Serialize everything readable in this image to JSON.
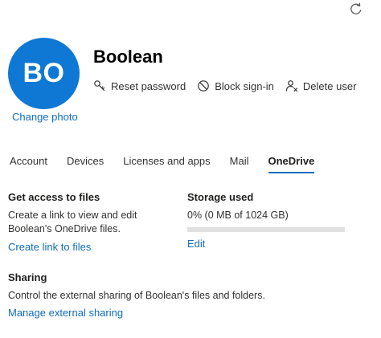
{
  "header": {
    "avatar_initials": "BO",
    "change_photo": "Change photo",
    "user_name": "Boolean",
    "actions": {
      "reset_password": "Reset password",
      "block_signin": "Block sign-in",
      "delete_user": "Delete user"
    }
  },
  "tabs": [
    {
      "label": "Account",
      "active": false
    },
    {
      "label": "Devices",
      "active": false
    },
    {
      "label": "Licenses and apps",
      "active": false
    },
    {
      "label": "Mail",
      "active": false
    },
    {
      "label": "OneDrive",
      "active": true
    }
  ],
  "get_access": {
    "title": "Get access to files",
    "description": "Create a link to view and edit Boolean's OneDrive files.",
    "link": "Create link to files"
  },
  "storage": {
    "title": "Storage used",
    "value_text": "0% (0 MB of 1024 GB)",
    "percent": 0,
    "edit": "Edit"
  },
  "sharing": {
    "title": "Sharing",
    "description": "Control the external sharing of Boolean's files and folders.",
    "link": "Manage external sharing"
  },
  "colors": {
    "accent": "#0f6cbd",
    "avatar_bg": "#0f78d4",
    "track": "#e1e1e1"
  },
  "icons": {
    "refresh": "refresh-icon",
    "reset_password": "key-icon",
    "block_signin": "block-icon",
    "delete_user": "delete-user-icon"
  }
}
